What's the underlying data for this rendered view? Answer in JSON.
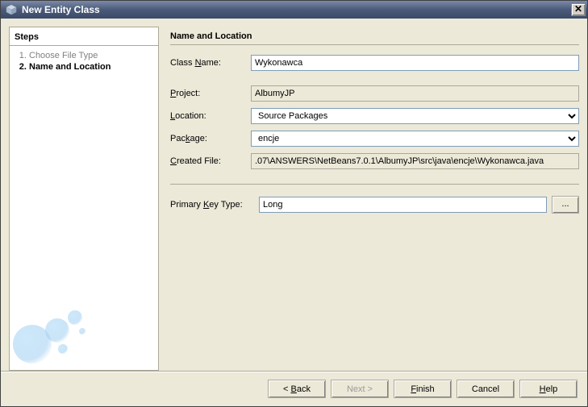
{
  "window": {
    "title": "New Entity Class"
  },
  "steps": {
    "heading": "Steps",
    "items": [
      {
        "label": "Choose File Type",
        "current": false
      },
      {
        "label": "Name and Location",
        "current": true
      }
    ]
  },
  "form": {
    "heading": "Name and Location",
    "className": {
      "label_pre": "Class ",
      "mnemonic": "N",
      "label_post": "ame:",
      "value": "Wykonawca"
    },
    "project": {
      "mnemonic": "P",
      "label_post": "roject:",
      "value": "AlbumyJP"
    },
    "location": {
      "mnemonic": "L",
      "label_post": "ocation:",
      "options": [
        "Source Packages"
      ],
      "value": "Source Packages"
    },
    "package": {
      "label_pre": "Pac",
      "mnemonic": "k",
      "label_post": "age:",
      "options": [
        "encje"
      ],
      "value": "encje"
    },
    "createdFile": {
      "mnemonic": "C",
      "label_post": "reated File:",
      "value": ".07\\ANSWERS\\NetBeans7.0.1\\AlbumyJP\\src\\java\\encje\\Wykonawca.java"
    },
    "pkType": {
      "label_pre": "Primary ",
      "mnemonic": "K",
      "label_post": "ey Type:",
      "value": "Long",
      "browse": "..."
    }
  },
  "buttons": {
    "back": {
      "prefix": "< ",
      "mnemonic": "B",
      "rest": "ack"
    },
    "next": {
      "label": "Next >",
      "disabled": true
    },
    "finish": {
      "mnemonic": "F",
      "rest": "inish"
    },
    "cancel": {
      "label": "Cancel"
    },
    "help": {
      "mnemonic": "H",
      "rest": "elp"
    }
  }
}
